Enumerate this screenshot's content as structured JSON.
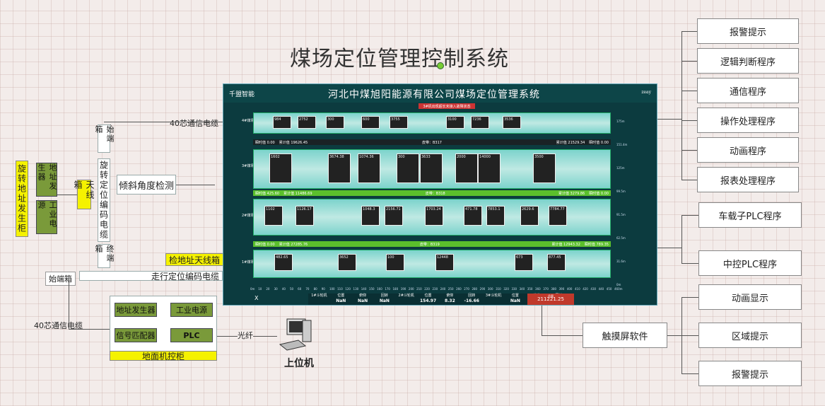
{
  "title": "煤场定位管理控制系统",
  "left": {
    "antenna_cabinet": "旋转地址发生柜",
    "addr_gen": "地址发生器",
    "ind_power": "工业电源",
    "antenna_box": "天线箱",
    "start_box": "始端箱",
    "rotary_cable": "旋转定位编码电缆",
    "end_box": "终端箱",
    "tilt": "倾斜角度检测",
    "cable40_top": "40芯通信电缆",
    "addr_antenna": "检地址天线箱",
    "walking_cable": "走行定位编码电缆",
    "start_box2": "始端箱",
    "cable40_bottom": "40芯通信电缆",
    "ground_cabinet": "地面机控柜",
    "gc_addr": "地址发生器",
    "gc_power": "工业电源",
    "gc_signal": "信号匹配器",
    "gc_plc": "PLC",
    "fiber": "光纤",
    "host": "上位机"
  },
  "right_top": [
    "报警提示",
    "逻辑判断程序",
    "通信程序",
    "操作处理程序",
    "动画程序",
    "报表处理程序"
  ],
  "right_mid": [
    "车载子PLC程序",
    "中控PLC程序"
  ],
  "right_bottom": [
    "动画显示",
    "区域提示",
    "报警提示"
  ],
  "touch": "触摸屏软件",
  "screen": {
    "logo": "千盟智能",
    "title": "河北中煤旭阳能源有限公司煤场定位管理系统",
    "user": "zeay",
    "alert": "3#机出现超长未接入故障状态",
    "rows": [
      "4#煤场",
      "3#煤场",
      "2#煤场",
      "1#煤场"
    ],
    "rails": [
      {
        "left": "瞬时值 0.00",
        "mid": "累计值 19626.45",
        "center": "皮带：B317",
        "right": "累计值 21529.34",
        "far": "瞬时值 0.00"
      },
      {
        "left": "瞬时值 425.60",
        "mid": "累计值 11486.69",
        "center": "皮带：B318",
        "right": "累计值 3279.86",
        "far": "瞬时值 0.00"
      },
      {
        "left": "瞬时值 0.00",
        "mid": "累计值 27285.76",
        "center": "皮带：B319",
        "right": "累计值 12943.32",
        "far": "瞬时值 789.35"
      }
    ],
    "ylabels": [
      "175m",
      "151.4m",
      "125m",
      "99.5m",
      "91.5m",
      "62.5m",
      "31.6m",
      "0m"
    ],
    "xlabels": [
      "0m",
      "10",
      "20",
      "30",
      "40",
      "50",
      "60",
      "70",
      "80",
      "90",
      "100",
      "110",
      "120",
      "130",
      "140",
      "150",
      "160",
      "170",
      "180",
      "190",
      "200",
      "210",
      "220",
      "230",
      "240",
      "250",
      "260",
      "270",
      "280",
      "290",
      "300",
      "310",
      "320",
      "330",
      "340",
      "350",
      "360",
      "370",
      "380",
      "390",
      "400",
      "410",
      "420",
      "430",
      "440",
      "450",
      "460m"
    ],
    "piles_row4": [
      "984",
      "2752",
      "300",
      "600",
      "3755",
      "3100",
      "7236",
      "3536"
    ],
    "piles_row3": [
      "1602",
      "3674.38",
      "1074.36",
      "300",
      "3633",
      "2000",
      "14000",
      "3500"
    ],
    "piles_row2": [
      "1102",
      "1126.17",
      "1048.3",
      "2156.71",
      "1703.24",
      "471.78",
      "7853.1",
      "2629.6",
      "7784.77"
    ],
    "piles_row1": [
      "482.65",
      "3652",
      "100",
      "12448",
      "673",
      "877.45"
    ],
    "bottom_vals": [
      {
        "l": "1#斗轮机",
        "v": ""
      },
      {
        "l": "位置",
        "v": "NaN"
      },
      {
        "l": "俯仰",
        "v": "NaN"
      },
      {
        "l": "回转",
        "v": "NaN"
      },
      {
        "l": "2#斗轮机",
        "v": ""
      },
      {
        "l": "位置",
        "v": "154.97"
      },
      {
        "l": "俯仰",
        "v": "8.32"
      },
      {
        "l": "回转",
        "v": "-16.66"
      },
      {
        "l": "3#斗轮机",
        "v": ""
      },
      {
        "l": "位置",
        "v": "NaN"
      },
      {
        "l": "俯仰",
        "v": "NaN"
      },
      {
        "l": "回转",
        "v": "NaN"
      }
    ],
    "total_label": "总量",
    "total": "211221.25",
    "x_close": "X"
  }
}
